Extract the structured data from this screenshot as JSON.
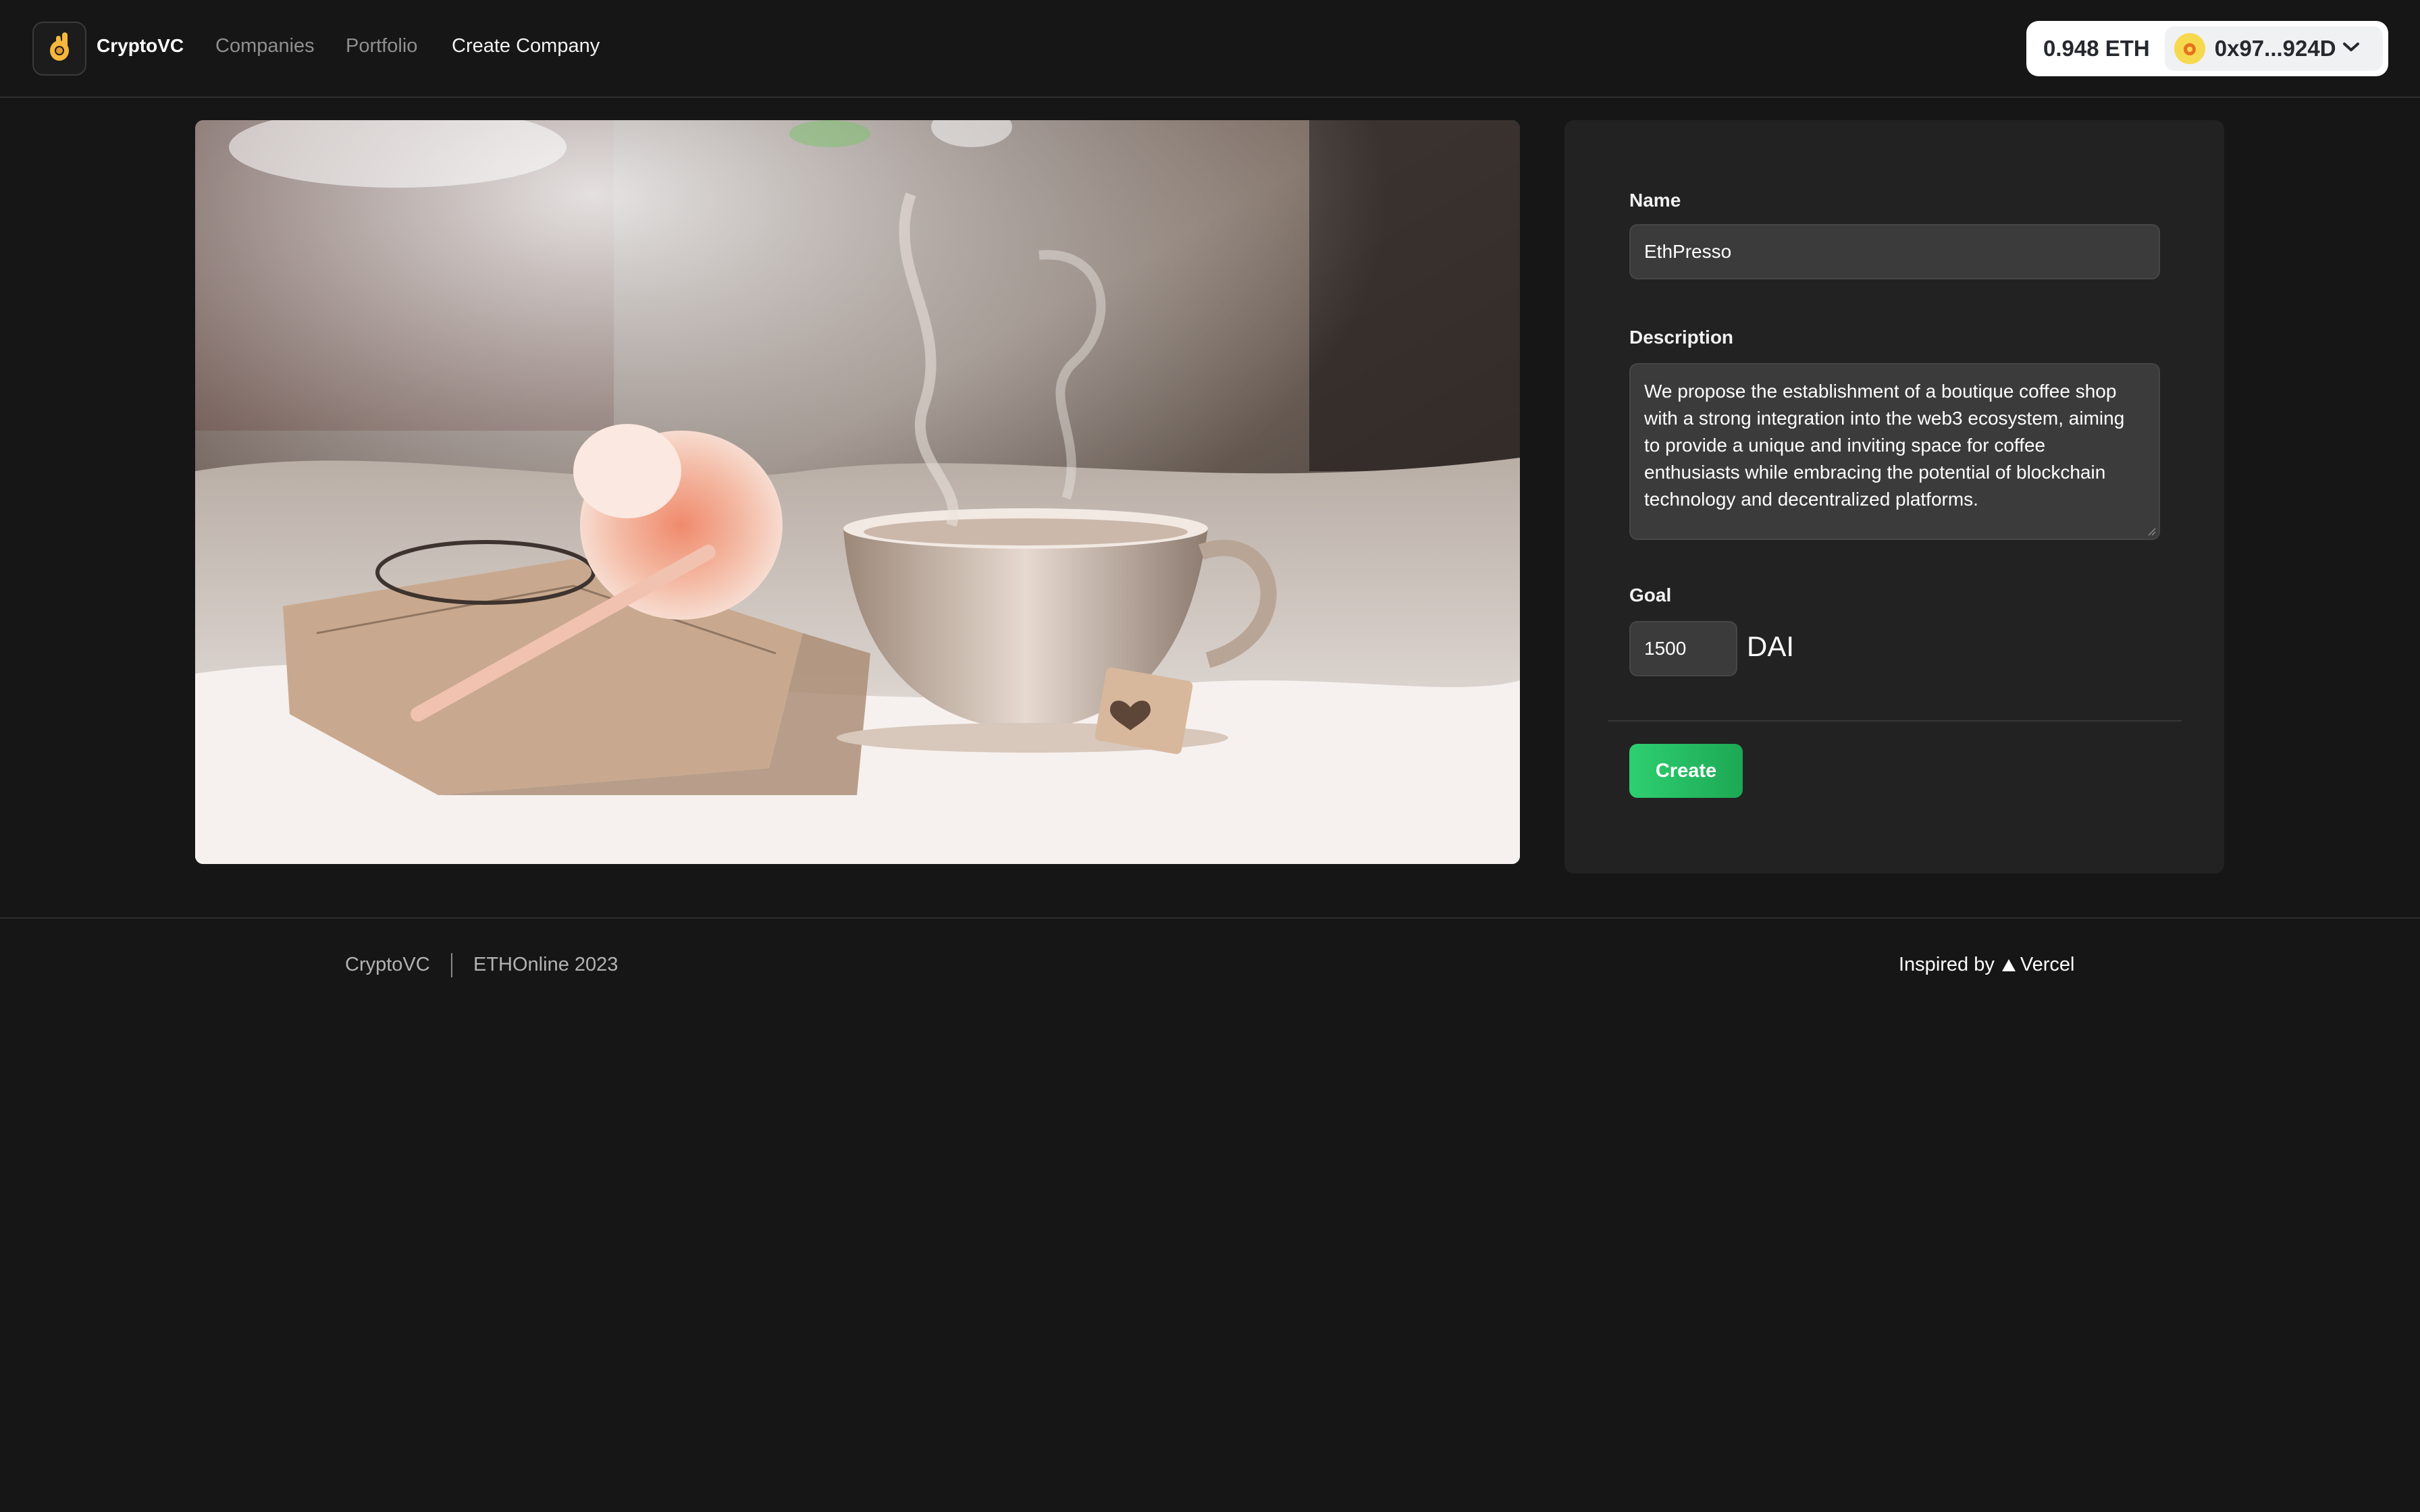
{
  "header": {
    "brand": "CryptoVC",
    "logo_icon": "ok-hand-emoji-icon",
    "nav": [
      {
        "label": "Companies",
        "active": false
      },
      {
        "label": "Portfolio",
        "active": false
      },
      {
        "label": "Create Company",
        "active": true
      }
    ],
    "wallet": {
      "balance": "0.948 ETH",
      "address": "0x97...924D",
      "avatar_icon": "account-avatar-icon",
      "dropdown_icon": "chevron-down-icon"
    }
  },
  "main": {
    "image": {
      "subject": "steaming teacup on open book with pink flower"
    },
    "form": {
      "name_label": "Name",
      "name_value": "EthPresso",
      "description_label": "Description",
      "description_value": "We propose the establishment of a boutique coffee shop with a strong integration into the web3 ecosystem, aiming to provide a unique and inviting space for coffee enthusiasts while embracing the potential of blockchain technology and decentralized platforms.",
      "goal_label": "Goal",
      "goal_value": "1500",
      "goal_unit": "DAI",
      "create_label": "Create"
    }
  },
  "footer": {
    "left": [
      "CryptoVC",
      "ETHOnline 2023"
    ],
    "credit_prefix": "Inspired by",
    "credit_icon": "vercel-triangle-icon",
    "credit_name": "Vercel"
  },
  "colors": {
    "background": "#161616",
    "card": "#222222",
    "input": "#3b3b3b",
    "accent": "#22c55e",
    "wallet_bg": "#ffffff"
  }
}
